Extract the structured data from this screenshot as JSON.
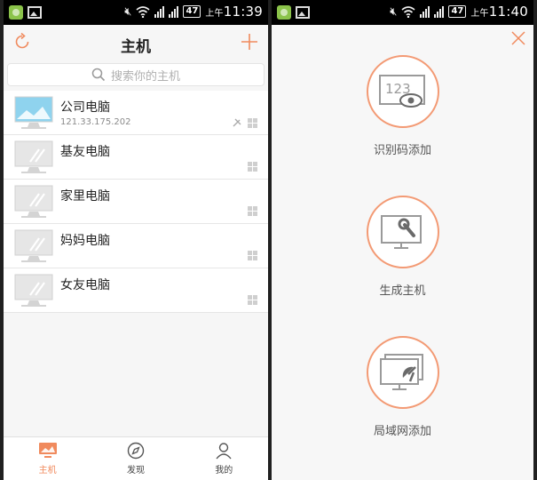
{
  "status_bar_left": {
    "time_prefix": "上午",
    "time": "11:39",
    "battery": "47"
  },
  "status_bar_right": {
    "time_prefix": "上午",
    "time": "11:40",
    "battery": "47"
  },
  "header": {
    "title": "主机"
  },
  "search": {
    "placeholder": "搜索你的主机"
  },
  "hosts": [
    {
      "name": "公司电脑",
      "ip": "121.33.175.202",
      "online": true
    },
    {
      "name": "基友电脑",
      "ip": "",
      "online": false
    },
    {
      "name": "家里电脑",
      "ip": "",
      "online": false
    },
    {
      "name": "妈妈电脑",
      "ip": "",
      "online": false
    },
    {
      "name": "女友电脑",
      "ip": "",
      "online": false
    }
  ],
  "tabs": [
    {
      "label": "主机",
      "icon": "host-icon",
      "active": true
    },
    {
      "label": "发现",
      "icon": "compass-icon",
      "active": false
    },
    {
      "label": "我的",
      "icon": "user-icon",
      "active": false
    }
  ],
  "add_options": [
    {
      "label": "识别码添加",
      "icon": "id-code-icon",
      "code_text": "123"
    },
    {
      "label": "生成主机",
      "icon": "generate-host-icon"
    },
    {
      "label": "局域网添加",
      "icon": "lan-add-icon"
    }
  ],
  "colors": {
    "accent": "#f08a5d",
    "online_screen": "#8fd3ee",
    "offline_screen": "#e6e6e6"
  }
}
